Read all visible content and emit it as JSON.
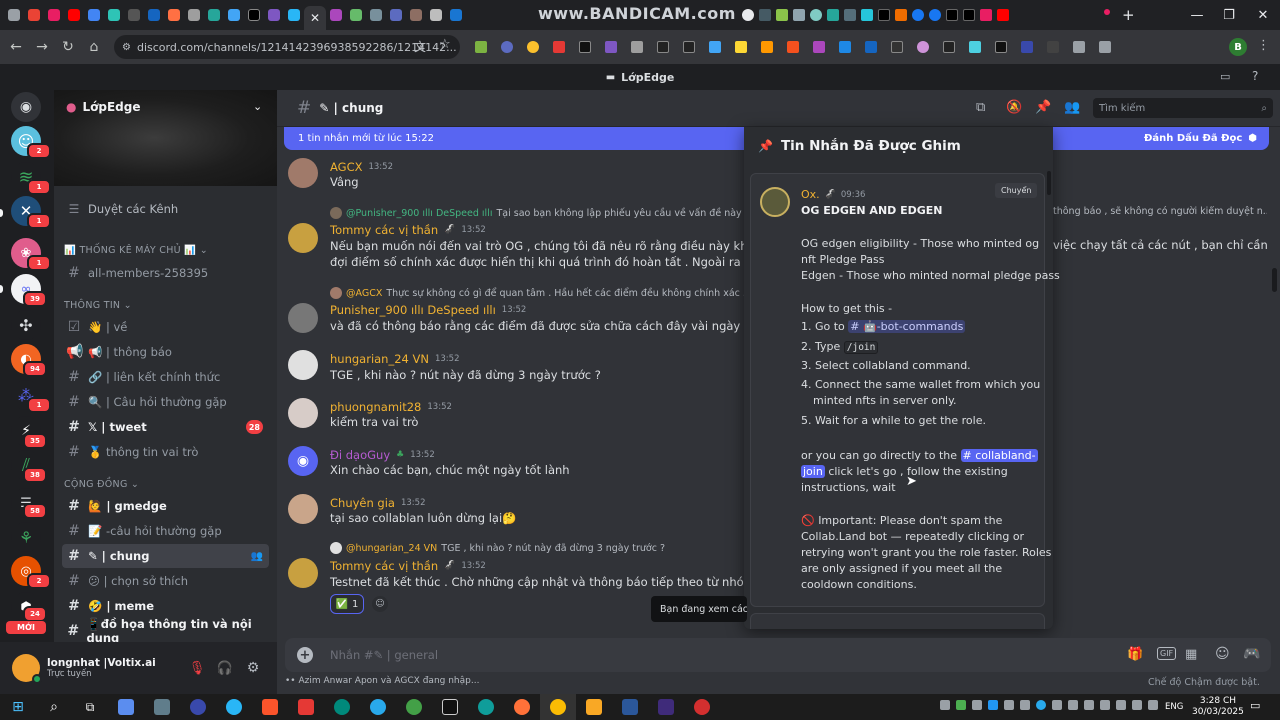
{
  "browser": {
    "url": "discord.com/channels/1214142396938592286/1214142...",
    "watermark": "www.BANDICAM.com",
    "profile_initial": "B"
  },
  "discord": {
    "window_title": "LớpEdge",
    "server_name": "LớpEdge",
    "browse_channels": "Duyệt các Kênh",
    "channel_name": "✎ | chung",
    "search_placeholder": "Tìm kiếm",
    "new_messages": "1 tin nhắn mới từ lúc 15:22",
    "mark_read": "Đánh Dấu Đã Đọc"
  },
  "sidebar": {
    "cat_stats": "📊 THỐNG KÊ MÁY CHỦ 📊",
    "stats_channel": "all-members-258395",
    "cat_info": "THÔNG TIN",
    "info_channels": [
      "👋 | về",
      "📢 | thông báo",
      "🔗 | liên kết chính thức",
      "🔍 | Câu hỏi thường gặp",
      "𝕏 | tweet",
      "🥇 thông tin vai trò"
    ],
    "tweet_badge": "28",
    "cat_community": "CỘNG ĐỒNG",
    "community_channels": [
      "🙋 | gmedge",
      "📝 -câu hỏi thường gặp",
      "✎ | chung",
      "😕 | chọn sở thích",
      "🤣 | meme",
      "📱đồ họa thông tin và nội dung"
    ]
  },
  "servers": {
    "badges": [
      "2",
      "1",
      "1",
      "1",
      "39",
      "1",
      "94",
      "1",
      "35",
      "38",
      "58",
      "2",
      "24"
    ],
    "new_label": "MỚI"
  },
  "user": {
    "name": "longnhat |Voltix.ai",
    "status": "Trực tuyến"
  },
  "messages": [
    {
      "reply_user": "",
      "reply_text": "",
      "user": "AGCX",
      "time": "13:52",
      "text": "Vâng",
      "color": "#f0b232"
    },
    {
      "reply_user": "@Punisher_900 ıllı DeSpeed ıllı",
      "reply_text": "Tại sao bạn không lập phiếu yêu cầu về vấn đề này ? Tôi đã g",
      "user": "Tommy các vị thần",
      "time": "13:52",
      "text": "Nếu bạn muốn nói đến vai trò OG , chúng tôi đã nêu rõ rằng điều này không bắt buộc",
      "text2": "đợi điểm số chính xác được hiển thị khi quá trình đó hoàn tất . Ngoài ra , chúng tôi đ",
      "color": "#f0b232"
    },
    {
      "reply_user": "@AGCX",
      "reply_text": "Thực sự không có gì để quan tâm . Hầu hết các điểm đều không chính xác . Đã nêu r",
      "user": "Punisher_900 ıllı DeSpeed ıllı",
      "time": "13:52",
      "text": "và đã có thông báo rằng các điểm đã được sửa chữa cách đây vài ngày . đó là lý do tạ",
      "color": "#f0b232"
    },
    {
      "reply_user": "",
      "reply_text": "",
      "user": "hungarian_24 VN",
      "time": "13:52",
      "text": "TGE , khi nào ? nút này đã dừng 3 ngày trước ?",
      "color": "#f0b232"
    },
    {
      "reply_user": "",
      "reply_text": "",
      "user": "phuongnamit28",
      "time": "13:52",
      "text": "kiểm tra vai trò",
      "color": "#f0b232"
    },
    {
      "reply_user": "",
      "reply_text": "",
      "user": "Đi dạoGuy",
      "time": "13:52",
      "text": "Xin chào các bạn, chúc một ngày tốt lành",
      "color": "#b55bd1"
    },
    {
      "reply_user": "",
      "reply_text": "",
      "user": "Chuyên gia",
      "time": "13:52",
      "text": "tại sao collablan luôn dừng lại🤔",
      "color": "#f0b232"
    },
    {
      "reply_user": "@hungarian_24 VN",
      "reply_text": "TGE , khi nào ? nút này đã dừng 3 ngày trước ?",
      "user": "Tommy các vị thần",
      "time": "13:52",
      "text": "Testnet đã kết thúc . Chờ những cập nhật và thông báo tiếp theo từ nhóm .",
      "color": "#f0b232"
    }
  ],
  "right_overflow": {
    "line1": "thông báo , sẽ không có người kiểm duyệt n...",
    "line2": "việc chạy tất cả các nút , bạn chỉ cần"
  },
  "reaction": {
    "emoji": "✅",
    "count": "1"
  },
  "pinned": {
    "title": "Tin Nhắn Đã Được Ghim",
    "author": "Ox.",
    "time": "09:36",
    "jump": "Chuyển",
    "heading": "OG EDGEN AND EDGEN",
    "lines": [
      "OG edgen eligibility - Those who minted og",
      "nft Pledge Pass",
      "Edgen - Those who minted normal pledge pass",
      "How to get this -"
    ],
    "step1_prefix": "1. Go to",
    "step1_channel": "# 🤖-bot-commands",
    "step2_prefix": "2. Type",
    "step2_code": "/join",
    "step3": "3. Select collabland command.",
    "step4a": "4. Connect the same wallet from which you",
    "step4b": "minted nfts in server only.",
    "step5": "5. Wait for a while to get the role.",
    "or_prefix": "or you can go directly to the",
    "or_channel_a": "# collabland-",
    "or_channel_b": "join",
    "or_rest": "click let's go , follow the existing",
    "or_rest2": "instructions, wait",
    "important_lines": [
      "🚫 Important: Please don't spam the",
      "Collab.Land bot — repeatedly clicking or",
      "retrying won't grant you the role faster. Roles",
      "are only assigned if you meet all the",
      "cooldown conditions."
    ]
  },
  "composer": {
    "placeholder": "Nhắn #✎ | general",
    "typing": "•• Azim Anwar Apon và AGCX đang nhập...",
    "slowmode": "Chế độ Chậm được bật.",
    "tooltip": "Bạn đang xem các t"
  },
  "taskbar": {
    "lang": "ENG",
    "time": "3:28 CH",
    "date": "30/03/2025"
  },
  "colors": {
    "accent": "#5865f2",
    "background": "#313338",
    "sidebar": "#2b2d31",
    "rail": "#1e1f22"
  }
}
